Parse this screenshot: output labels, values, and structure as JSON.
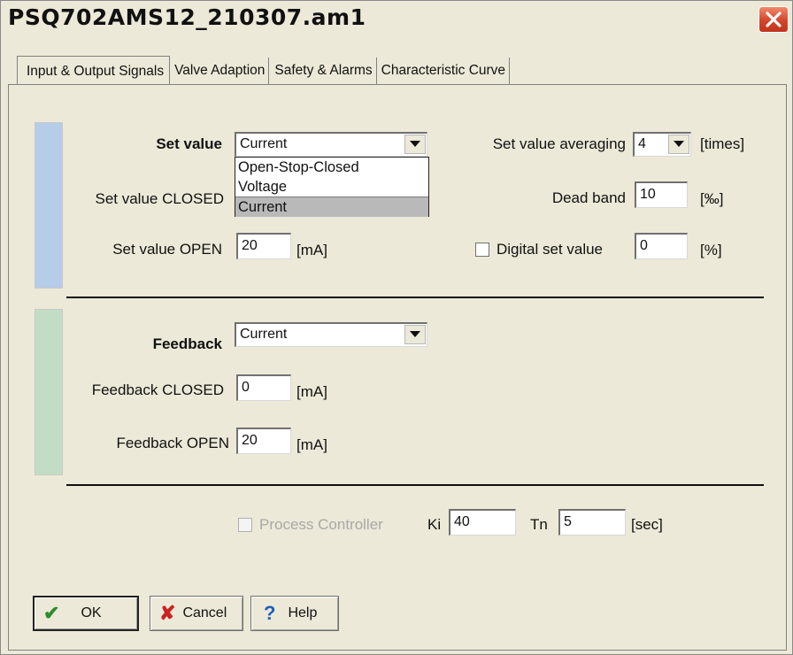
{
  "window": {
    "title": "PSQ702AMS12_210307.am1"
  },
  "tabs": [
    {
      "label": "Input & Output Signals"
    },
    {
      "label": "Valve Adaption"
    },
    {
      "label": "Safety & Alarms"
    },
    {
      "label": "Characteristic Curve"
    }
  ],
  "set_value": {
    "label": "Set value",
    "selected": "Current",
    "dropdown_options": [
      "Open-Stop-Closed",
      "Voltage",
      "Current"
    ],
    "highlighted_option": "Current",
    "closed_label": "Set value CLOSED",
    "open_label": "Set value OPEN",
    "open_value": "20",
    "open_unit": "[mA]",
    "averaging_label": "Set value averaging",
    "averaging_value": "4",
    "averaging_unit": "[times]",
    "dead_band_label": "Dead band",
    "dead_band_value": "10",
    "dead_band_unit": "[‰]",
    "digital_label": "Digital set value",
    "digital_checked": false,
    "digital_value": "0",
    "digital_unit": "[%]"
  },
  "feedback": {
    "label": "Feedback",
    "selected": "Current",
    "closed_label": "Feedback CLOSED",
    "closed_value": "0",
    "closed_unit": "[mA]",
    "open_label": "Feedback OPEN",
    "open_value": "20",
    "open_unit": "[mA]"
  },
  "controller": {
    "label": "Process Controller",
    "checked": false,
    "enabled": false,
    "ki_label": "Ki",
    "ki_value": "40",
    "tn_label": "Tn",
    "tn_value": "5",
    "tn_unit": "[sec]"
  },
  "buttons": {
    "ok": "OK",
    "cancel": "Cancel",
    "help": "Help"
  },
  "colors": {
    "set_value_stripe": "#b6cdea",
    "feedback_stripe": "#c3ddc5",
    "ok_icon": "#2e8b2e",
    "cancel_icon": "#cc2222",
    "help_icon": "#1e5fbf"
  },
  "icons": {
    "close": "close-x-icon",
    "ok": "checkmark-icon",
    "cancel": "x-cross-icon",
    "help": "question-mark-icon",
    "dropdown": "chevron-down-icon"
  }
}
